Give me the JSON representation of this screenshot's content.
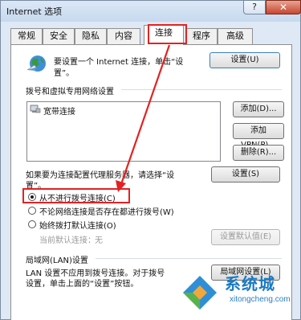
{
  "window": {
    "title": "Internet 选项",
    "help_label": "?",
    "close_label": "✕"
  },
  "tabs": [
    {
      "label": "常规"
    },
    {
      "label": "安全"
    },
    {
      "label": "隐私"
    },
    {
      "label": "内容"
    },
    {
      "label": "连接",
      "active": true
    },
    {
      "label": "程序"
    },
    {
      "label": "高级"
    }
  ],
  "setup": {
    "text_line1": "要设置一个 Internet 连接，单击“设",
    "text_line2": "置”。",
    "button": "设置(U)"
  },
  "dialup": {
    "heading": "拨号和虚拟专用网络设置",
    "list_items": [
      "宽带连接"
    ],
    "add_button": "添加(D)...",
    "add_vpn_button": "添加 VPN(P)...",
    "remove_button": "删除(R)...",
    "settings_button": "设置(S)",
    "proxy_text_line1": "如果要为连接配置代理服务器，请选择“设",
    "proxy_text_line2": "置”。",
    "options": [
      {
        "label": "从不进行拨号连接(C)",
        "checked": true
      },
      {
        "label": "不论网络连接是否存在都进行拨号(W)",
        "checked": false
      },
      {
        "label": "始终拨打默认连接(O)",
        "checked": false
      }
    ],
    "current_default_label": "当前默认连接：",
    "current_default_value": "无",
    "set_default_button": "设置默认值(E)"
  },
  "lan": {
    "heading": "局域网(LAN)设置",
    "text_line1": "LAN 设置不应用到拨号连接。对于拨号",
    "text_line2": "设置，单击上面的“设置”按钮。",
    "button": "局域网设置(L)"
  },
  "watermark": {
    "brand": "系统城",
    "url": "xitongcheng.com"
  },
  "colors": {
    "highlight": "#e32222",
    "window_bg": "#dfe9f5",
    "close_button": "#c7462f"
  }
}
